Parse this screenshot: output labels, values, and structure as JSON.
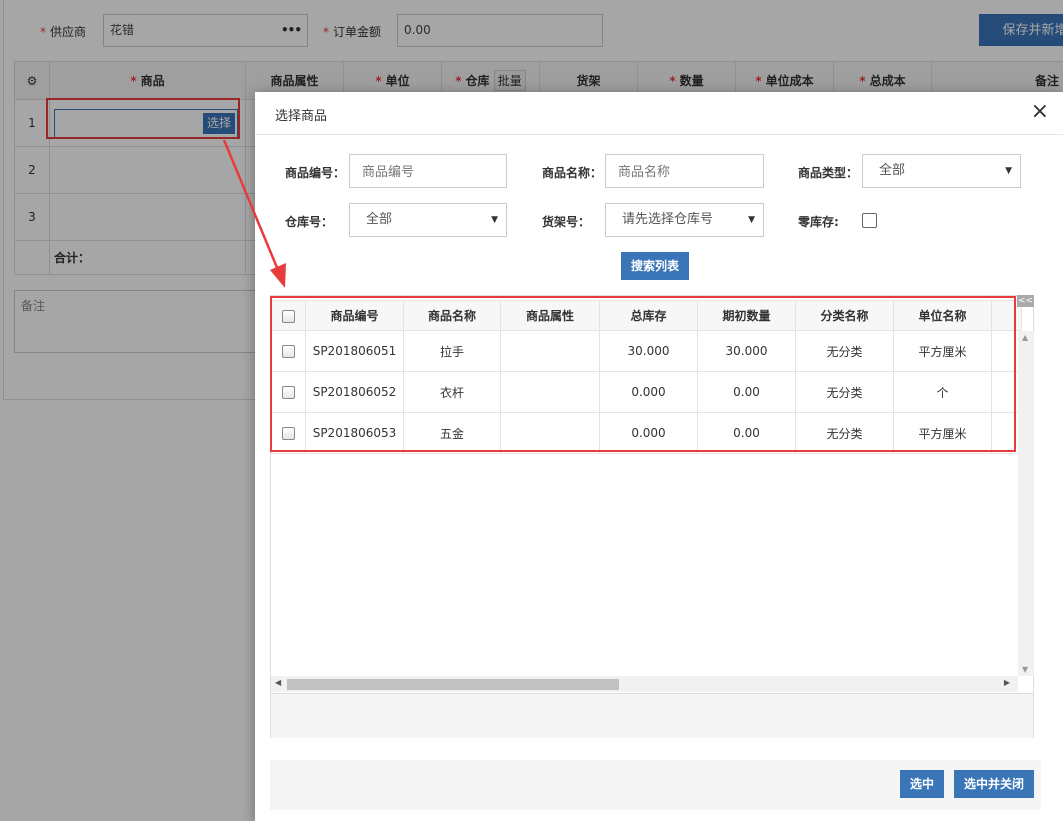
{
  "form": {
    "supplier_label": "供应商",
    "supplier_value": "花错",
    "supplier_more": "•••",
    "amount_label": "订单金额",
    "amount_value": "0.00",
    "save_new_button": "保存并新增",
    "required_mark": "*",
    "columns": {
      "gear": "⚙",
      "product": "商品",
      "attr": "商品属性",
      "unit": "单位",
      "warehouse": "仓库",
      "batch": "批量",
      "shelf": "货架",
      "qty": "数量",
      "unit_cost": "单位成本",
      "total_cost": "总成本",
      "remark": "备注"
    },
    "rows": [
      "1",
      "2",
      "3"
    ],
    "select_button": "选择",
    "total_label": "合计：",
    "remark_placeholder": "备注"
  },
  "modal": {
    "title": "选择商品",
    "close": "×",
    "filters": {
      "code_label": "商品编号：",
      "code_placeholder": "商品编号",
      "name_label": "商品名称：",
      "name_placeholder": "商品名称",
      "type_label": "商品类型：",
      "type_value": "全部",
      "warehouse_label": "仓库号：",
      "warehouse_value": "全部",
      "shelf_label": "货架号：",
      "shelf_value": "请先选择仓库号",
      "zero_stock_label": "零库存:"
    },
    "search_button": "搜索列表",
    "collapse": "<<",
    "table": {
      "headers": [
        "商品编号",
        "商品名称",
        "商品属性",
        "总库存",
        "期初数量",
        "分类名称",
        "单位名称"
      ],
      "rows": [
        [
          "SP201806051",
          "拉手",
          "",
          "30.000",
          "30.000",
          "无分类",
          "平方厘米"
        ],
        [
          "SP201806052",
          "衣杆",
          "",
          "0.000",
          "0.00",
          "无分类",
          "个"
        ],
        [
          "SP201806053",
          "五金",
          "",
          "0.000",
          "0.00",
          "无分类",
          "平方厘米"
        ]
      ]
    },
    "buttons": {
      "select": "选中",
      "select_close": "选中并关闭"
    }
  },
  "colors": {
    "primary": "#3a75b8",
    "highlight": "#e93b3b",
    "required": "#e4393c"
  }
}
